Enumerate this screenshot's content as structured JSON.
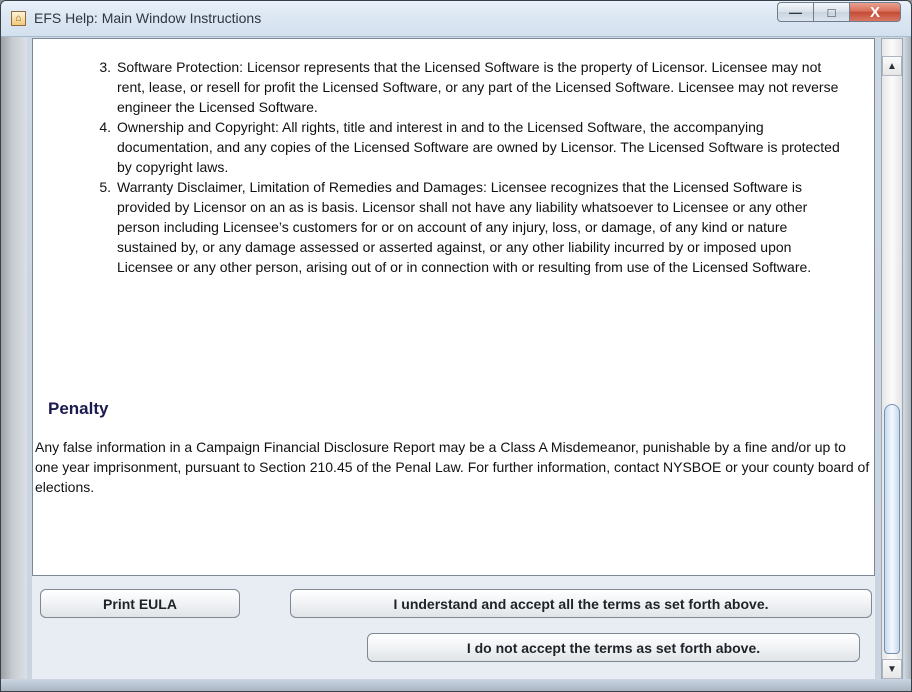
{
  "window": {
    "title": "EFS Help: Main Window Instructions",
    "controls": {
      "minimize": "—",
      "maximize": "□",
      "close": "X"
    }
  },
  "content": {
    "items": [
      {
        "num": "3.",
        "text": "Software Protection: Licensor represents that the Licensed Software is the property of Licensor. Licensee may not rent, lease, or resell for profit the Licensed Software, or any part of the Licensed Software. Licensee may not reverse engineer the Licensed Software."
      },
      {
        "num": "4.",
        "text": "Ownership and Copyright: All rights, title and interest in and to the Licensed Software, the accompanying documentation, and any copies of the Licensed Software are owned by Licensor. The Licensed Software is protected by copyright laws."
      },
      {
        "num": "5.",
        "text": "Warranty Disclaimer, Limitation of Remedies and Damages: Licensee recognizes that the Licensed Software is provided by Licensor on an as is basis. Licensor shall not have any liability whatsoever to Licensee or any other person including Licensee’s customers for or on account of any injury, loss, or damage, of any kind or nature sustained by, or any damage assessed or asserted against, or any other liability incurred by or imposed upon Licensee or any other person, arising out of or in connection with or resulting from use of the Licensed Software."
      }
    ],
    "penalty": {
      "heading": "Penalty",
      "text": "Any false information in a Campaign Financial Disclosure Report may be a Class A Misdemeanor, punishable by a fine and/or up to one year imprisonment, pursuant to Section 210.45 of the Penal Law. For further information, contact NYSBOE or your county board of elections."
    }
  },
  "buttons": {
    "print": "Print EULA",
    "accept": "I understand and accept all the terms as set forth above.",
    "decline": "I do not accept the terms as set forth above."
  },
  "scrollbar": {
    "up_icon": "▲",
    "down_icon": "▼"
  }
}
